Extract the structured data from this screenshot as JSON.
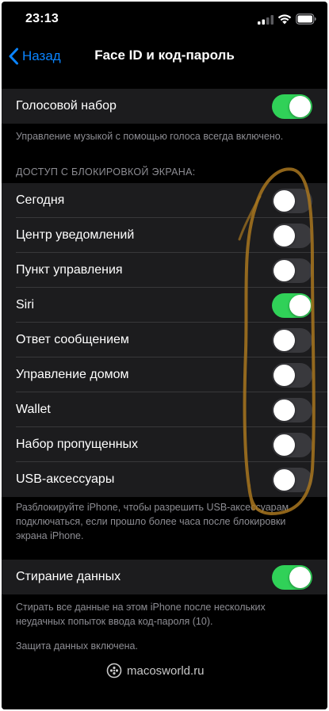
{
  "status_bar": {
    "time": "23:13"
  },
  "nav": {
    "back_label": "Назад",
    "title": "Face ID и код-пароль"
  },
  "voice_dial": {
    "label": "Голосовой набор",
    "enabled": true,
    "footer": "Управление музыкой с помощью голоса всегда включено."
  },
  "lock_screen_access": {
    "header": "ДОСТУП С БЛОКИРОВКОЙ ЭКРАНА:",
    "items": [
      {
        "label": "Сегодня",
        "enabled": false
      },
      {
        "label": "Центр уведомлений",
        "enabled": false
      },
      {
        "label": "Пункт управления",
        "enabled": false
      },
      {
        "label": "Siri",
        "enabled": true
      },
      {
        "label": "Ответ сообщением",
        "enabled": false
      },
      {
        "label": "Управление домом",
        "enabled": false
      },
      {
        "label": "Wallet",
        "enabled": false
      },
      {
        "label": "Набор пропущенных",
        "enabled": false
      },
      {
        "label": "USB-аксессуары",
        "enabled": false
      }
    ],
    "footer": "Разблокируйте iPhone, чтобы разрешить USB-аксессуарам подключаться, если прошло более часа после блокировки экрана iPhone."
  },
  "erase_data": {
    "label": "Стирание данных",
    "enabled": true,
    "footer": "Стирать все данные на этом iPhone после нескольких неудачных попыток ввода код-пароля (10).",
    "footer_status": "Защита данных включена."
  },
  "watermark": {
    "text": "macosworld.ru"
  },
  "colors": {
    "accent_blue": "#0a84ff",
    "toggle_on": "#30d158",
    "toggle_off": "#39393d",
    "cell_background": "#1c1c1e",
    "annotation_stroke": "#a8761e"
  },
  "icons": {
    "back": "chevron-left-icon",
    "signal": "cellular-signal-icon",
    "wifi": "wifi-icon",
    "battery": "battery-icon",
    "watermark_logo": "macosworld-logo-icon"
  }
}
